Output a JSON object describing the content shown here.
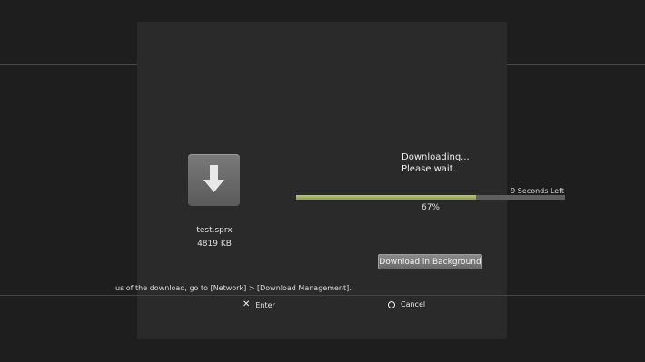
{
  "file": {
    "name": "test.sprx",
    "size": "4819 KB",
    "icon": "download-arrow-icon"
  },
  "status": {
    "line1": "Downloading...",
    "line2": "Please wait.",
    "time_left": "9 Seconds Left",
    "percent_label": "67%",
    "progress": 0.67
  },
  "buttons": {
    "download_background": "Download in Background"
  },
  "info_text": "us of the download, go to [Network] > [Download Management].",
  "hints": {
    "enter_icon": "cross-icon",
    "enter_label": "Enter",
    "cancel_icon": "circle-icon",
    "cancel_label": "Cancel"
  },
  "colors": {
    "progress_fill": "#9aaa5a",
    "progress_track": "#5f5f5f"
  }
}
